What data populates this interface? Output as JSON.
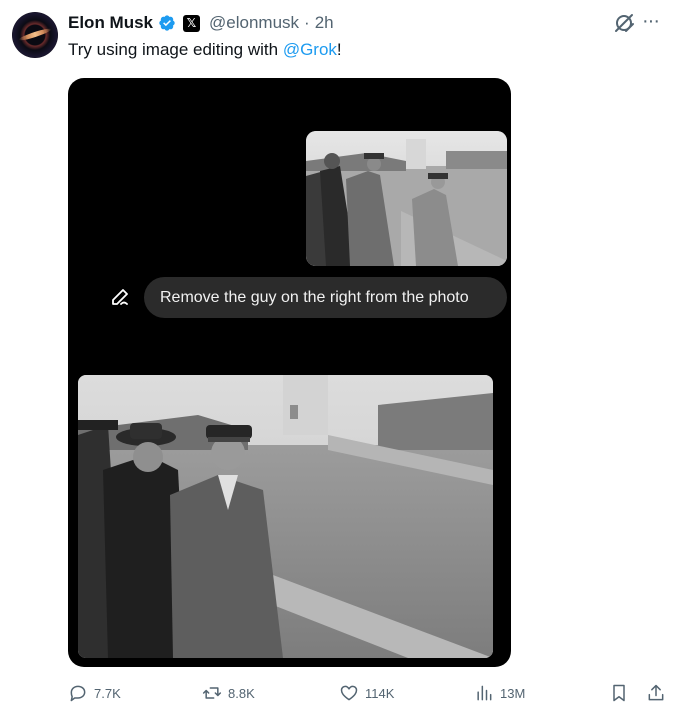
{
  "post": {
    "author_name": "Elon Musk",
    "handle": "@elonmusk",
    "separator": "·",
    "time": "2h",
    "text_before": "Try using image editing with ",
    "mention": "@Grok",
    "text_after": "!",
    "verified_badge_color": "#1d9bf0",
    "affiliate_badge": "𝕏"
  },
  "media": {
    "prompt": "Remove the guy on the right from the photo",
    "background": "#000000"
  },
  "actions": {
    "replies": "7.7K",
    "reposts": "8.8K",
    "likes": "114K",
    "views": "13M"
  },
  "icons": {
    "grok": "grok-icon",
    "more": "more-icon",
    "reply": "reply-icon",
    "repost": "repost-icon",
    "like": "heart-icon",
    "views": "views-icon",
    "bookmark": "bookmark-icon",
    "share": "share-icon",
    "edit": "pen-icon"
  }
}
